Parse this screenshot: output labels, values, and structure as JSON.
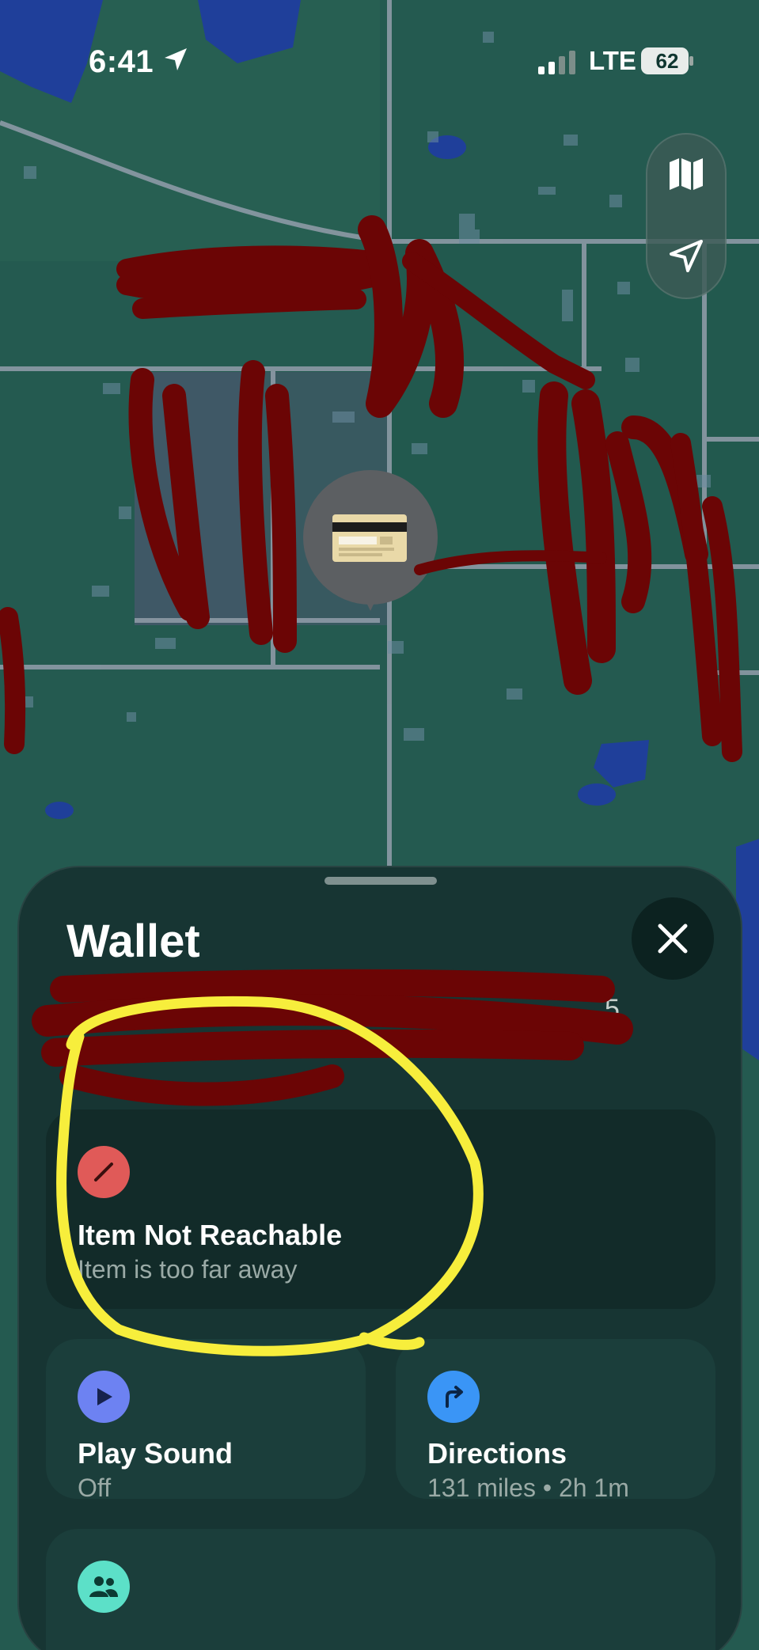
{
  "status_bar": {
    "time": "6:41",
    "network": "LTE",
    "battery": "62",
    "icons": [
      "location-arrow-icon",
      "signal-bars-icon",
      "battery-icon"
    ]
  },
  "map": {
    "controls": [
      "map-icon",
      "location-arrow-icon"
    ],
    "pin_item": "card-icon",
    "colors": {
      "land": "#245a50",
      "road": "#8d9aa6",
      "water": "#1f3f9a",
      "scribble": "#6b0505"
    }
  },
  "sheet": {
    "title": "Wallet",
    "subtitle_visible_fragment": "5",
    "close_icon": "close-icon",
    "status": {
      "label": "Item Not Reachable",
      "detail": "Item is too far away",
      "icon": "slash-icon",
      "color": "#e05a58"
    },
    "play_sound": {
      "label": "Play Sound",
      "detail": "Off",
      "icon": "play-icon",
      "color": "#6d82f2"
    },
    "directions": {
      "label": "Directions",
      "detail": "131 miles • 2h 1m",
      "icon": "turn-right-arrow-icon",
      "color": "#3a95f6"
    },
    "people": {
      "icon": "people-icon",
      "color": "#5ce0c8"
    }
  },
  "annotation": {
    "highlight_color": "#f7ee3c"
  }
}
